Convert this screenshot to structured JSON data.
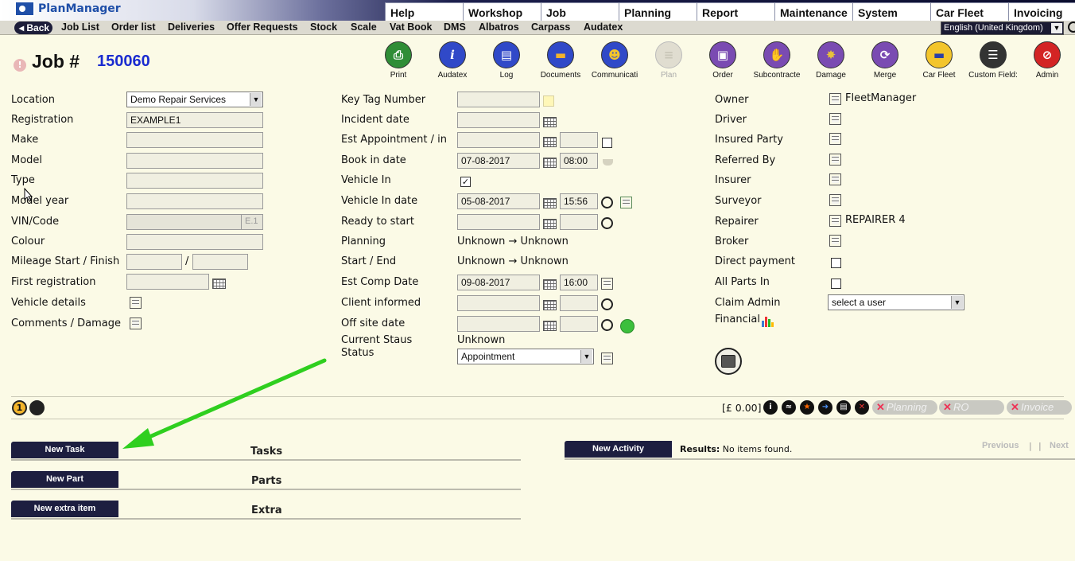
{
  "app": {
    "logo_text": "PlanManager"
  },
  "main_tabs": [
    "Help",
    "Workshop",
    "Job",
    "Planning",
    "Report",
    "Maintenance",
    "System",
    "Car Fleet",
    "Invoicing"
  ],
  "nav": {
    "back": "Back",
    "items": [
      "Job List",
      "Order list",
      "Deliveries",
      "Offer Requests",
      "Stock",
      "Scale",
      "Vat Book",
      "DMS",
      "Albatros",
      "Carpass",
      "Audatex"
    ],
    "language": "English (United Kingdom)"
  },
  "job": {
    "title": "Job #",
    "number": "150060"
  },
  "toolbar": [
    "Print",
    "Audatex",
    "Log",
    "Documents",
    "Communicati",
    "Plan",
    "Order",
    "Subcontracte",
    "Damage",
    "Merge",
    "Car Fleet",
    "Custom Field:",
    "Admin"
  ],
  "left": {
    "location_label": "Location",
    "location_value": "Demo Repair Services",
    "registration_label": "Registration",
    "registration_value": "EXAMPLE1",
    "make_label": "Make",
    "model_label": "Model",
    "type_label": "Type",
    "model_year_label": "Model year",
    "vin_label": "VIN/Code",
    "vin_suffix": "E.1",
    "colour_label": "Colour",
    "mileage_label": "Mileage Start / Finish",
    "mileage_sep": "/",
    "first_reg_label": "First registration",
    "vehicle_details_label": "Vehicle details",
    "comments_label": "Comments / Damage"
  },
  "middle": {
    "key_tag_label": "Key Tag Number",
    "incident_label": "Incident date",
    "est_appt_label": "Est Appointment / in",
    "book_in_label": "Book in date",
    "book_in_date": "07-08-2017",
    "book_in_time": "08:00",
    "vehicle_in_label": "Vehicle In",
    "vehicle_in_checked": "✓",
    "vehicle_in_date_label": "Vehicle In date",
    "vehicle_in_date": "05-08-2017",
    "vehicle_in_time": "15:56",
    "ready_label": "Ready to start",
    "planning_label": "Planning",
    "planning_value": "Unknown → Unknown",
    "start_end_label": "Start / End",
    "start_end_value": "Unknown → Unknown",
    "est_comp_label": "Est Comp Date",
    "est_comp_date": "09-08-2017",
    "est_comp_time": "16:00",
    "client_informed_label": "Client informed",
    "off_site_label": "Off site date",
    "current_status_label": "Current Staus",
    "current_status_value": "Unknown",
    "status_label": "Status",
    "status_value": "Appointment"
  },
  "right": {
    "owner_label": "Owner",
    "owner_value": "FleetManager",
    "driver_label": "Driver",
    "insured_label": "Insured Party",
    "referred_label": "Referred By",
    "insurer_label": "Insurer",
    "surveyor_label": "Surveyor",
    "repairer_label": "Repairer",
    "repairer_value": "REPAIRER 4",
    "broker_label": "Broker",
    "direct_payment_label": "Direct payment",
    "all_parts_label": "All Parts In",
    "claim_admin_label": "Claim Admin",
    "claim_admin_value": "select a user",
    "financial_label": "Financial"
  },
  "statusbar": {
    "badge": "1",
    "amount": "[£ 0.00]",
    "planning": "Planning",
    "ro": "RO",
    "invoice": "Invoice"
  },
  "sections": {
    "new_task": "New Task",
    "tasks": "Tasks",
    "new_part": "New Part",
    "parts": "Parts",
    "new_extra": "New extra item",
    "extra": "Extra",
    "new_activity": "New Activity",
    "results_label": "Results:",
    "results_value": "No items found.",
    "previous": "Previous",
    "pipe": "|",
    "next": "Next"
  },
  "colors": {
    "accent_blue": "#1a2bd0",
    "dark_button": "#1d1e40",
    "background": "#fbfae6",
    "arrow_green": "#2fcf1f"
  }
}
